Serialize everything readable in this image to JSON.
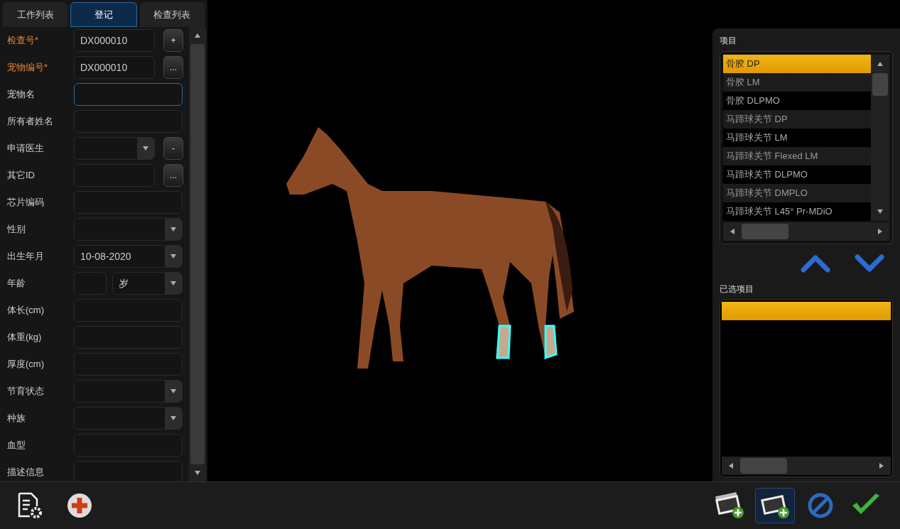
{
  "tabs": [
    {
      "label": "工作列表",
      "selected": false
    },
    {
      "label": "登记",
      "selected": true
    },
    {
      "label": "检查列表",
      "selected": false
    }
  ],
  "form": [
    {
      "label": "检查号*",
      "required": true,
      "kind": "text",
      "value": "DX000010",
      "button": "+"
    },
    {
      "label": "宠物编号*",
      "required": true,
      "kind": "text",
      "value": "DX000010",
      "button": "..."
    },
    {
      "label": "宠物名",
      "required": false,
      "kind": "text",
      "focused": true
    },
    {
      "label": "所有者姓名",
      "required": false,
      "kind": "text"
    },
    {
      "label": "申请医生",
      "required": false,
      "kind": "select",
      "button": "-"
    },
    {
      "label": "其它ID",
      "required": false,
      "kind": "text",
      "button": "..."
    },
    {
      "label": "芯片编码",
      "required": false,
      "kind": "text"
    },
    {
      "label": "性别",
      "required": false,
      "kind": "select"
    },
    {
      "label": "出生年月",
      "required": false,
      "kind": "select",
      "value": "10-08-2020"
    },
    {
      "label": "年龄",
      "required": false,
      "kind": "age",
      "unit": "岁"
    },
    {
      "label": "体长(cm)",
      "required": false,
      "kind": "text"
    },
    {
      "label": "体重(kg)",
      "required": false,
      "kind": "text"
    },
    {
      "label": "厚度(cm)",
      "required": false,
      "kind": "text"
    },
    {
      "label": "节育状态",
      "required": false,
      "kind": "select"
    },
    {
      "label": "种族",
      "required": false,
      "kind": "select"
    },
    {
      "label": "血型",
      "required": false,
      "kind": "text"
    },
    {
      "label": "描述信息",
      "required": false,
      "kind": "text"
    }
  ],
  "items_panel": {
    "title": "项目",
    "items": [
      {
        "label": "骨胶 DP",
        "selected": true
      },
      {
        "label": "骨胶 LM",
        "selected": false
      },
      {
        "label": "骨胶 DLPMO",
        "selected": false
      },
      {
        "label": "马蹄球关节 DP",
        "selected": false
      },
      {
        "label": "马蹄球关节 LM",
        "selected": false
      },
      {
        "label": "马蹄球关节 Flexed LM",
        "selected": false
      },
      {
        "label": "马蹄球关节 DLPMO",
        "selected": false
      },
      {
        "label": "马蹄球关节 DMPLO",
        "selected": false
      },
      {
        "label": "马蹄球关节 L45° Pr-MDiO",
        "selected": false
      }
    ]
  },
  "selected_panel": {
    "title": "已选项目"
  },
  "toolbar_right": [
    {
      "kind": "add-images",
      "selected": false
    },
    {
      "kind": "add-image",
      "selected": true
    },
    {
      "kind": "cancel",
      "selected": false
    },
    {
      "kind": "confirm",
      "selected": false
    }
  ]
}
